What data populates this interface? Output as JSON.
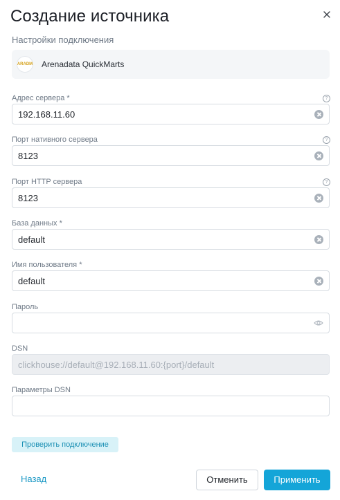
{
  "dialog": {
    "title": "Создание источника",
    "close_icon": "close-icon"
  },
  "connection": {
    "section_title": "Настройки подключения",
    "source_name": "Arenadata QuickMarts",
    "source_logo_text": "ARADM"
  },
  "fields": {
    "server_address": {
      "label": "Адрес сервера",
      "required": "*",
      "value": "192.168.11.60"
    },
    "native_port": {
      "label": "Порт нативного сервера",
      "value": "8123"
    },
    "http_port": {
      "label": "Порт HTTP сервера",
      "value": "8123"
    },
    "database": {
      "label": "База данных",
      "required": "*",
      "value": "default"
    },
    "username": {
      "label": "Имя пользователя",
      "required": "*",
      "value": "default"
    },
    "password": {
      "label": "Пароль",
      "value": ""
    },
    "dsn": {
      "label": "DSN",
      "value": "clickhouse://default@192.168.11.60:{port}/default"
    },
    "dsn_params": {
      "label": "Параметры DSN",
      "value": ""
    }
  },
  "help_glyph": "?",
  "actions": {
    "check_connection": "Проверить подключение",
    "back": "Назад",
    "cancel": "Отменить",
    "apply": "Применить"
  },
  "colors": {
    "accent": "#14a5d8",
    "link": "#1897c4",
    "check_bg": "#d8f2f8"
  }
}
